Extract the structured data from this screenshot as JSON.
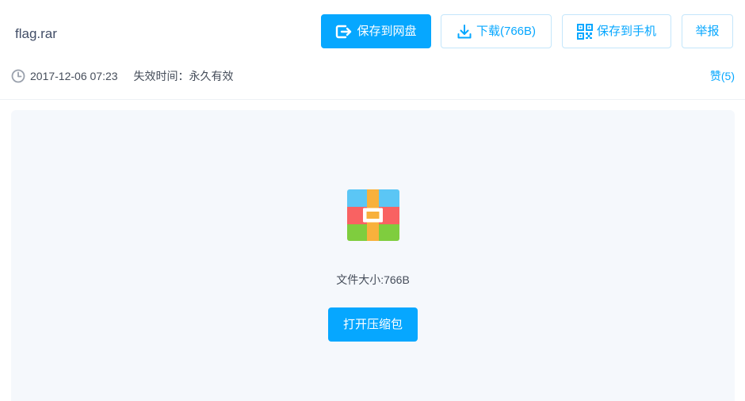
{
  "file": {
    "name": "flag.rar"
  },
  "toolbar": {
    "save_to_cloud_label": "保存到网盘",
    "download_label": "下载(766B)",
    "save_to_phone_label": "保存到手机",
    "report_label": "举报"
  },
  "meta": {
    "share_time": "2017-12-06 07:23",
    "expiry_prefix": "失效时间：",
    "expiry_value": "永久有效",
    "like_label": "赞(5)"
  },
  "preview": {
    "icon": "rar-archive-icon",
    "file_size_label": "文件大小:766B",
    "open_archive_label": "打开压缩包"
  },
  "colors": {
    "accent": "#06a7ff",
    "panel_background": "#f5f8fc",
    "archive_top": "#5bc6f5",
    "archive_middle": "#f96262",
    "archive_bottom": "#7fcd3e",
    "archive_strap": "#f8b13c"
  }
}
